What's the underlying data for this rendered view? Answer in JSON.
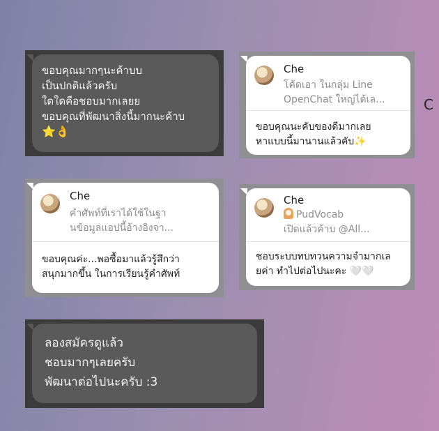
{
  "screenshot1": {
    "lines": [
      "ขอบคุณมากๆนะค้าบบ",
      "เป็นปกติแล้วครับ",
      "ใดใดคือชอบมากเลยย",
      "ขอบคุณที่พัฒนาสิ่งนี้มากนะค้าบ"
    ],
    "emoji": [
      "⭐",
      "👌"
    ]
  },
  "screenshot2": {
    "reply_name": "Che",
    "reply_quote": [
      "โค้ดเอา ในกลุ่ม Line",
      "OpenChat ใหญ่ได้เล..."
    ],
    "body": [
      "ขอบคุณนะคับของดีมากเลย",
      "หาแบบนี้มานานแล้วคับ"
    ],
    "emoji": "✨",
    "stray_char": "C"
  },
  "screenshot3": {
    "reply_name": "Che",
    "reply_quote": [
      "คำศัพท์ที่เราได้ใช้ในฐา",
      "นข้อมูลแอปนี้อ้างอิงจา..."
    ],
    "body": [
      "ขอบคุณค่ะ...พอซื้อมาแล้วรู้สึกว่า",
      "สนุกมากขึ้น ในการเรียนรู้คำศัพท์"
    ]
  },
  "screenshot4": {
    "reply_name": "Che",
    "reply_quote": [
      "PudVocab",
      "เปิดแล้วค้าบ @All..."
    ],
    "body": [
      "ชอบระบบทบทวนความจำมากเล",
      "ยค่า ทำไปต่อไปนะคะ"
    ],
    "emoji": "🤍🤍"
  },
  "screenshot5": {
    "lines": [
      "ลองสมัครดูแล้ว",
      "ชอบมากๆเลยครับ",
      "พัฒนาต่อไปนะครับ :3"
    ]
  }
}
